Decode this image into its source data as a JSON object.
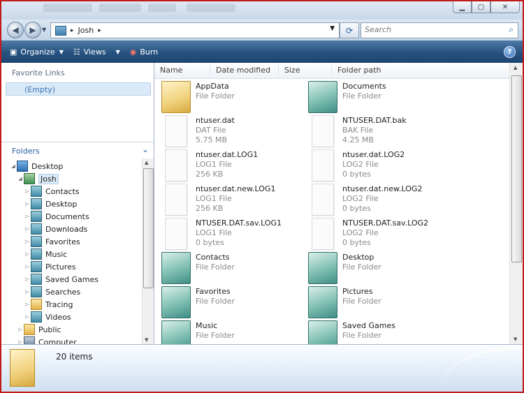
{
  "window": {
    "controls": {
      "minimize": "▁",
      "maximize": "▢",
      "close": "✕"
    }
  },
  "nav": {
    "back": "◀",
    "forward": "▶",
    "breadcrumb": [
      "Josh"
    ],
    "search_placeholder": "Search"
  },
  "toolbar": {
    "organize": "Organize",
    "views": "Views",
    "burn": "Burn",
    "help": "?"
  },
  "left_pane": {
    "favorite_links_title": "Favorite Links",
    "favorite_links_empty": "(Empty)",
    "folders_title": "Folders",
    "tree": [
      {
        "label": "Desktop",
        "level": 0,
        "expanded": true,
        "icon": "desktop-icon"
      },
      {
        "label": "Josh",
        "level": 1,
        "expanded": true,
        "selected": true,
        "icon": "user-folder-icon"
      },
      {
        "label": "Contacts",
        "level": 2,
        "icon": "contacts-icon"
      },
      {
        "label": "Desktop",
        "level": 2,
        "icon": "desktop-folder-icon"
      },
      {
        "label": "Documents",
        "level": 2,
        "icon": "documents-icon"
      },
      {
        "label": "Downloads",
        "level": 2,
        "icon": "downloads-icon"
      },
      {
        "label": "Favorites",
        "level": 2,
        "icon": "favorites-icon"
      },
      {
        "label": "Music",
        "level": 2,
        "icon": "music-icon"
      },
      {
        "label": "Pictures",
        "level": 2,
        "icon": "pictures-icon"
      },
      {
        "label": "Saved Games",
        "level": 2,
        "icon": "saved-games-icon"
      },
      {
        "label": "Searches",
        "level": 2,
        "icon": "searches-icon"
      },
      {
        "label": "Tracing",
        "level": 2,
        "icon": "folder-icon"
      },
      {
        "label": "Videos",
        "level": 2,
        "icon": "videos-icon"
      },
      {
        "label": "Public",
        "level": 1,
        "icon": "folder-icon"
      },
      {
        "label": "Computer",
        "level": 1,
        "icon": "computer-icon"
      }
    ]
  },
  "columns": [
    "Name",
    "Date modified",
    "Size",
    "Folder path"
  ],
  "items": [
    {
      "name": "AppData",
      "type": "File Folder",
      "size": "",
      "icon": "folder"
    },
    {
      "name": "Documents",
      "type": "File Folder",
      "size": "",
      "icon": "special"
    },
    {
      "name": "ntuser.dat",
      "type": "DAT File",
      "size": "5.75 MB",
      "icon": "doc"
    },
    {
      "name": "NTUSER.DAT.bak",
      "type": "BAK File",
      "size": "4.25 MB",
      "icon": "doc"
    },
    {
      "name": "ntuser.dat.LOG1",
      "type": "LOG1 File",
      "size": "256 KB",
      "icon": "doc"
    },
    {
      "name": "ntuser.dat.LOG2",
      "type": "LOG2 File",
      "size": "0 bytes",
      "icon": "doc"
    },
    {
      "name": "ntuser.dat.new.LOG1",
      "type": "LOG1 File",
      "size": "256 KB",
      "icon": "doc"
    },
    {
      "name": "ntuser.dat.new.LOG2",
      "type": "LOG2 File",
      "size": "0 bytes",
      "icon": "doc"
    },
    {
      "name": "NTUSER.DAT.sav.LOG1",
      "type": "LOG1 File",
      "size": "0 bytes",
      "icon": "doc"
    },
    {
      "name": "NTUSER.DAT.sav.LOG2",
      "type": "LOG2 File",
      "size": "0 bytes",
      "icon": "doc"
    },
    {
      "name": "Contacts",
      "type": "File Folder",
      "size": "",
      "icon": "special"
    },
    {
      "name": "Desktop",
      "type": "File Folder",
      "size": "",
      "icon": "special"
    },
    {
      "name": "Favorites",
      "type": "File Folder",
      "size": "",
      "icon": "special"
    },
    {
      "name": "Pictures",
      "type": "File Folder",
      "size": "",
      "icon": "special"
    },
    {
      "name": "Music",
      "type": "File Folder",
      "size": "",
      "icon": "special"
    },
    {
      "name": "Saved Games",
      "type": "File Folder",
      "size": "",
      "icon": "special"
    }
  ],
  "status": {
    "count": "20 items"
  }
}
